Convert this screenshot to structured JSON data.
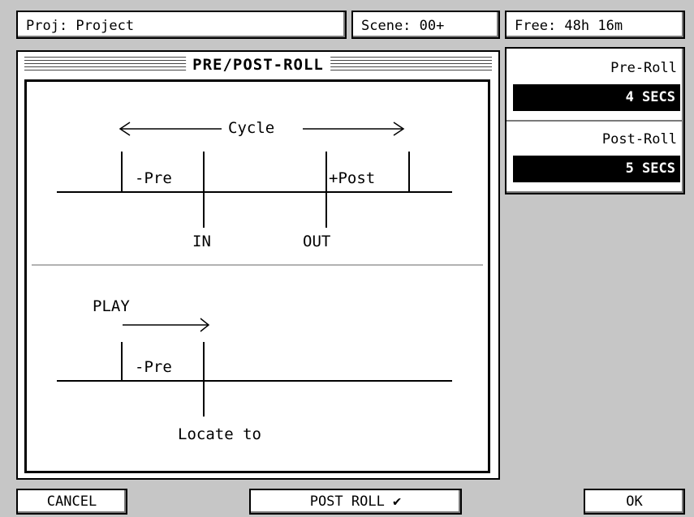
{
  "header": {
    "project_label": "Proj: Project",
    "scene_label": "Scene: 00+",
    "free_label": "Free: 48h 16m"
  },
  "window": {
    "title": "PRE/POST-ROLL"
  },
  "diagram": {
    "cycle_label": "Cycle",
    "pre_label": "-Pre",
    "post_label": "+Post",
    "in_label": "IN",
    "out_label": "OUT",
    "play_label": "PLAY",
    "pre_label_2": "-Pre",
    "locate_label": "Locate to"
  },
  "settings": {
    "pre_roll_label": "Pre-Roll",
    "pre_roll_value": "4 SECS",
    "post_roll_label": "Post-Roll",
    "post_roll_value": "5 SECS"
  },
  "buttons": {
    "cancel": "CANCEL",
    "post_roll": "POST ROLL ✔",
    "ok": "OK"
  }
}
